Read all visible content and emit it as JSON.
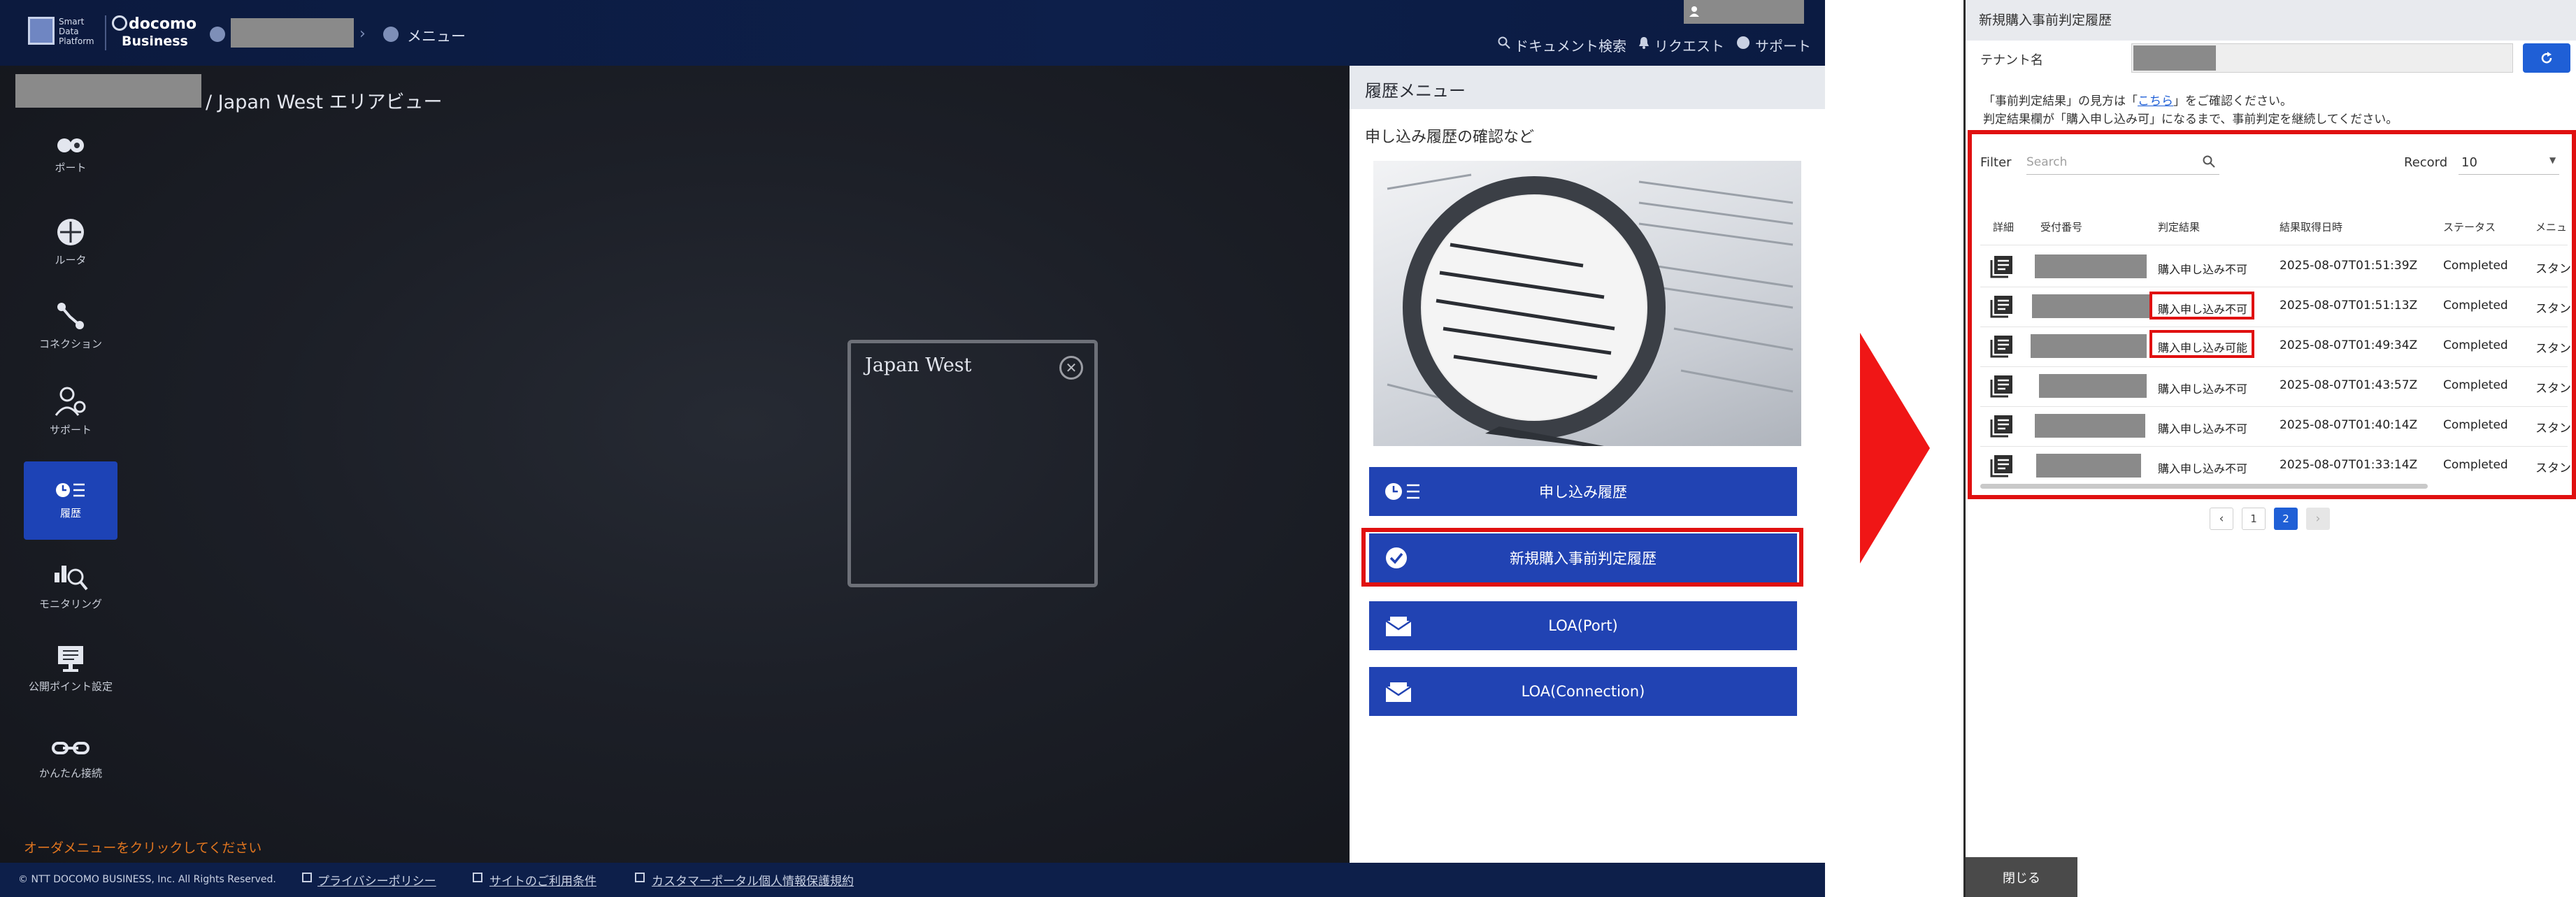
{
  "app": {
    "logo_text": [
      "Smart",
      "Data",
      "Platform"
    ],
    "brand_name": "docomo",
    "brand_sub": "Business",
    "breadcrumb_menu": "メニュー",
    "header_links": {
      "documents": "ドキュメント検索",
      "request": "リクエスト",
      "support": "サポート"
    },
    "area_title": "/ Japan West エリアビュー",
    "sidebar": [
      {
        "label": "ポート",
        "icon": "port-icon",
        "active": false
      },
      {
        "label": "ルータ",
        "icon": "router-icon",
        "active": false
      },
      {
        "label": "コネクション",
        "icon": "connection-icon",
        "active": false
      },
      {
        "label": "サポート",
        "icon": "support-icon",
        "active": false
      },
      {
        "label": "履歴",
        "icon": "history-icon",
        "active": true
      },
      {
        "label": "モニタリング",
        "icon": "monitoring-icon",
        "active": false
      },
      {
        "label": "公開ポイント設定",
        "icon": "monitor-icon",
        "active": false
      },
      {
        "label": "かんたん接続",
        "icon": "easy-connect-icon",
        "active": false
      }
    ],
    "region_card": {
      "title": "Japan West"
    },
    "order_hint": "オーダメニューをクリックしてください",
    "footer": {
      "copyright": "© NTT DOCOMO BUSINESS, Inc. All Rights Reserved.",
      "links": [
        "プライバシーポリシー",
        "サイトのご利用条件",
        "カスタマーポータル個人情報保護規約"
      ]
    },
    "history_panel": {
      "title": "履歴メニュー",
      "subtitle": "申し込み履歴の確認など",
      "buttons": [
        {
          "label": "申し込み履歴",
          "icon": "history-list-icon"
        },
        {
          "label": "新規購入事前判定履歴",
          "icon": "check-circle-icon"
        },
        {
          "label": "LOA(Port)",
          "icon": "mail-icon"
        },
        {
          "label": "LOA(Connection)",
          "icon": "mail-icon"
        }
      ]
    },
    "colors": {
      "accent": "#2143b3",
      "highlight": "#e01010",
      "topbar": "#0d1f4a"
    }
  },
  "dialog": {
    "title": "新規購入事前判定履歴",
    "tenant_label": "テナント名",
    "note_before_link": "「事前判定結果」の見方は「",
    "note_link": "こちら",
    "note_after_link": "」をご確認ください。",
    "note_line2": "判定結果欄が「購入申し込み可」になるまで、事前判定を継続してください。",
    "filter_label": "Filter",
    "search_placeholder": "Search",
    "record_label": "Record",
    "record_value": "10",
    "columns": [
      "詳細",
      "受付番号",
      "判定結果",
      "結果取得日時",
      "ステータス",
      "メニュ"
    ],
    "rows": [
      {
        "result": "購入申し込み不可",
        "datetime": "2025-08-07T01:51:39Z",
        "status": "Completed",
        "menu": "スタン",
        "highlight": false
      },
      {
        "result": "購入申し込み不可",
        "datetime": "2025-08-07T01:51:13Z",
        "status": "Completed",
        "menu": "スタン",
        "highlight": true
      },
      {
        "result": "購入申し込み可能",
        "datetime": "2025-08-07T01:49:34Z",
        "status": "Completed",
        "menu": "スタン",
        "highlight": true
      },
      {
        "result": "購入申し込み不可",
        "datetime": "2025-08-07T01:43:57Z",
        "status": "Completed",
        "menu": "スタン",
        "highlight": false
      },
      {
        "result": "購入申し込み不可",
        "datetime": "2025-08-07T01:40:14Z",
        "status": "Completed",
        "menu": "スタン",
        "highlight": false
      },
      {
        "result": "購入申し込み不可",
        "datetime": "2025-08-07T01:33:14Z",
        "status": "Completed",
        "menu": "スタン",
        "highlight": false
      }
    ],
    "pagination": {
      "prev": "‹",
      "pages": [
        "1",
        "2"
      ],
      "current": "2",
      "next": "›"
    },
    "close_label": "閉じる"
  }
}
